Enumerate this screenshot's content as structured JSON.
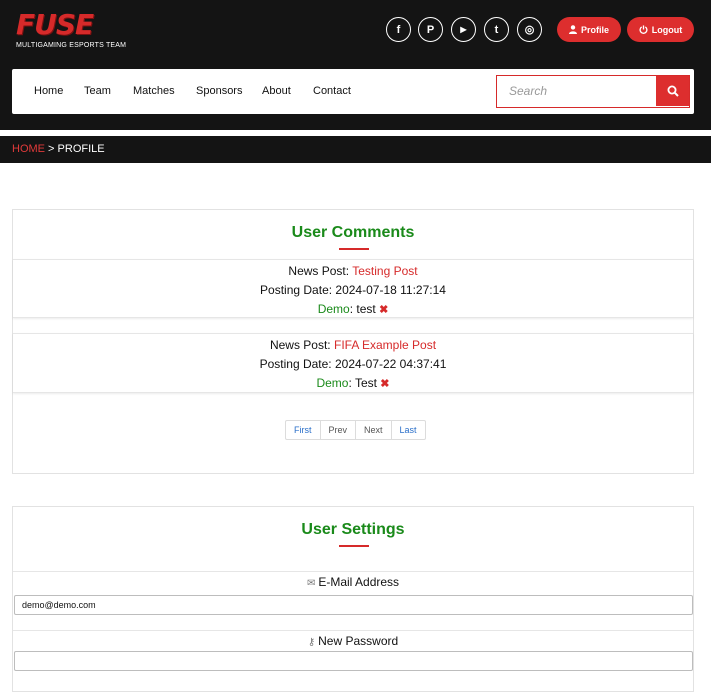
{
  "header": {
    "brand": "FUSE",
    "tagline": "MULTIGAMING ESPORTS TEAM",
    "social_icons": [
      "facebook-icon",
      "pinterest-icon",
      "youtube-icon",
      "twitter-icon",
      "instagram-icon"
    ],
    "social_glyphs": [
      "f",
      "P",
      "▶",
      "t",
      "◎"
    ],
    "profile_label": "Profile",
    "logout_label": "Logout"
  },
  "nav": {
    "items": [
      "Home",
      "Team",
      "Matches",
      "Sponsors",
      "About",
      "Contact"
    ],
    "search_placeholder": "Search"
  },
  "breadcrumb": {
    "home": "HOME",
    "sep": " > ",
    "current": "PROFILE"
  },
  "comments": {
    "title": "User Comments",
    "items": [
      {
        "post_label": "News Post: ",
        "post_title": "Testing Post",
        "date_label": "Posting Date: ",
        "date": "2024-07-18 11:27:14",
        "user": "Demo",
        "sep": ": ",
        "text": "test",
        "delete_glyph": "✖"
      },
      {
        "post_label": "News Post: ",
        "post_title": "FIFA Example Post",
        "date_label": "Posting Date: ",
        "date": "2024-07-22 04:37:41",
        "user": "Demo",
        "sep": ": ",
        "text": "Test",
        "delete_glyph": "✖"
      }
    ],
    "pager": {
      "first": "First",
      "prev": "Prev",
      "next": "Next",
      "last": "Last"
    }
  },
  "settings": {
    "title": "User Settings",
    "email_label": "E-Mail Address",
    "email_value": "demo@demo.com",
    "password_label": "New Password",
    "password_value": ""
  },
  "colors": {
    "accent": "#dd2e2e",
    "title_green": "#1a8a1a",
    "dark_bg": "#141414",
    "link_blue": "#2a6fc9"
  }
}
